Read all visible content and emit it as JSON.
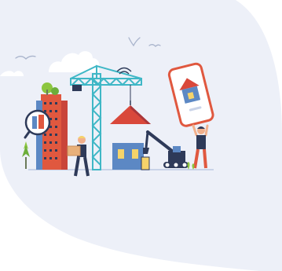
{
  "illustration": {
    "subject": "construction-scene",
    "colors": {
      "background_blob": "#EDF0F8",
      "cloud": "#FFFFFF",
      "building_red": "#E0583F",
      "building_blue": "#5C88C4",
      "crane_teal": "#3FB7C6",
      "roof_red": "#D9483B",
      "phone_frame": "#E0583F",
      "house_navy": "#2E3A59",
      "worker_skin": "#F2B08B",
      "tree_green": "#8CC63F",
      "excavator_navy": "#2E3A59",
      "ground_line": "#C9D3E8"
    }
  }
}
